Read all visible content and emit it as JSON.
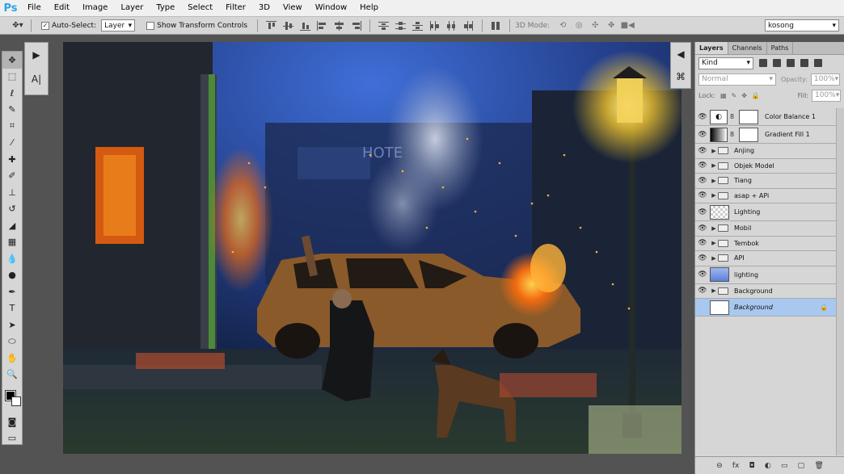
{
  "app": {
    "logo": "Ps"
  },
  "menu": [
    "File",
    "Edit",
    "Image",
    "Layer",
    "Type",
    "Select",
    "Filter",
    "3D",
    "View",
    "Window",
    "Help"
  ],
  "options": {
    "auto_select_label": "Auto-Select:",
    "auto_select_value": "Layer",
    "show_transform_label": "Show Transform Controls",
    "mode_3d_label": "3D Mode:",
    "workspace": "kosong"
  },
  "panel": {
    "tabs": [
      "Layers",
      "Channels",
      "Paths"
    ],
    "filter_kind": "Kind",
    "blend_mode": "Normal",
    "opacity_label": "Opacity:",
    "opacity_value": "100%",
    "lock_label": "Lock:",
    "fill_label": "Fill:",
    "fill_value": "100%",
    "layers": [
      {
        "name": "Color Balance 1",
        "type": "adjustment",
        "icon": "color-balance-icon"
      },
      {
        "name": "Gradient Fill 1",
        "type": "adjustment",
        "icon": "gradient-icon"
      },
      {
        "name": "Anjing",
        "type": "group"
      },
      {
        "name": "Objek Model",
        "type": "group"
      },
      {
        "name": "Tiang",
        "type": "group"
      },
      {
        "name": "asap + APi",
        "type": "group"
      },
      {
        "name": "Lighting",
        "type": "pixel"
      },
      {
        "name": "Mobil",
        "type": "group"
      },
      {
        "name": "Tembok",
        "type": "group"
      },
      {
        "name": "API",
        "type": "group"
      },
      {
        "name": "lighting",
        "type": "pixel"
      },
      {
        "name": "Background",
        "type": "group"
      },
      {
        "name": "Background",
        "type": "background",
        "locked": true,
        "selected": true
      }
    ]
  },
  "canvas": {
    "sign_text": "HOTE"
  },
  "colors": {
    "accent": "#2fa3e0",
    "selection": "#a8c8f0",
    "ui": "#d6d6d6"
  }
}
